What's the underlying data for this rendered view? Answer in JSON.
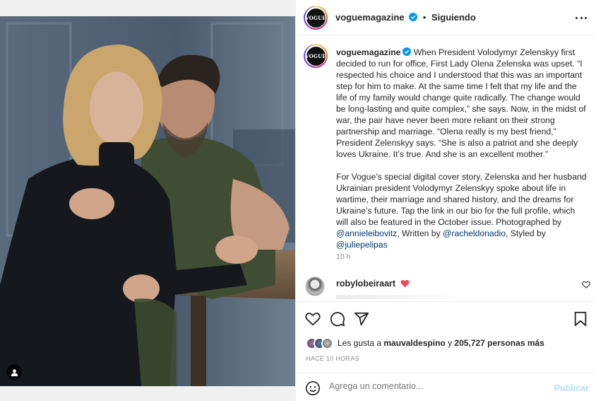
{
  "header": {
    "username": "voguemagazine",
    "separator": "•",
    "follow_label": "Siguiendo",
    "avatar_logo": "VOGUE"
  },
  "caption": {
    "username": "voguemagazine",
    "paragraph1": " When President Volodymyr Zelenskyy first decided to run for office, First Lady Olena Zelenska was upset. “I respected his choice and I understood that this was an important step for him to make. At the same time I felt that my life and the life of my family would change quite radically. The change would be long-lasting and quite complex,” she says. Now, in the midst of war, the pair have never been more reliant on their strong partnership and marriage. “Olena really is my best friend,” President Zelenskyy says. “She is also a patriot and she deeply loves Ukraine. It’s true. And she is an excellent mother.”",
    "paragraph2_text": "For Vogue’s special digital cover story, Zelenska and her husband Ukrainian president Volodymyr Zelenskyy spoke about life in wartime, their marriage and shared history, and the dreams for Ukraine’s future. Tap the link in our bio for the full profile, which will also be featured in the October issue. Photographed by ",
    "mention1": "@annieleibovitz",
    "written_by": ", Written by ",
    "mention2": "@racheldonadio",
    "styled_by": ", Styled by ",
    "mention3": "@juliepelipas",
    "time": "10 h"
  },
  "comment": {
    "username": "robylobeiraart"
  },
  "likes": {
    "prefix": "Les gusta a ",
    "user": "mauvaldespino",
    "middle": " y ",
    "count": "205,727 personas más"
  },
  "posted_ago": "HACE 10 HORAS",
  "add_comment": {
    "placeholder": "Agrega un comentario...",
    "post_label": "Publicar"
  },
  "colors": {
    "verified": "#0095f6",
    "heart": "#ed4956",
    "post_disabled": "#b2dffc",
    "mention": "#00376b"
  },
  "icons": [
    "user-tag-icon",
    "verified-icon",
    "more-icon",
    "heart-icon",
    "comment-icon",
    "share-icon",
    "bookmark-icon",
    "emoji-icon",
    "red-heart-icon"
  ]
}
